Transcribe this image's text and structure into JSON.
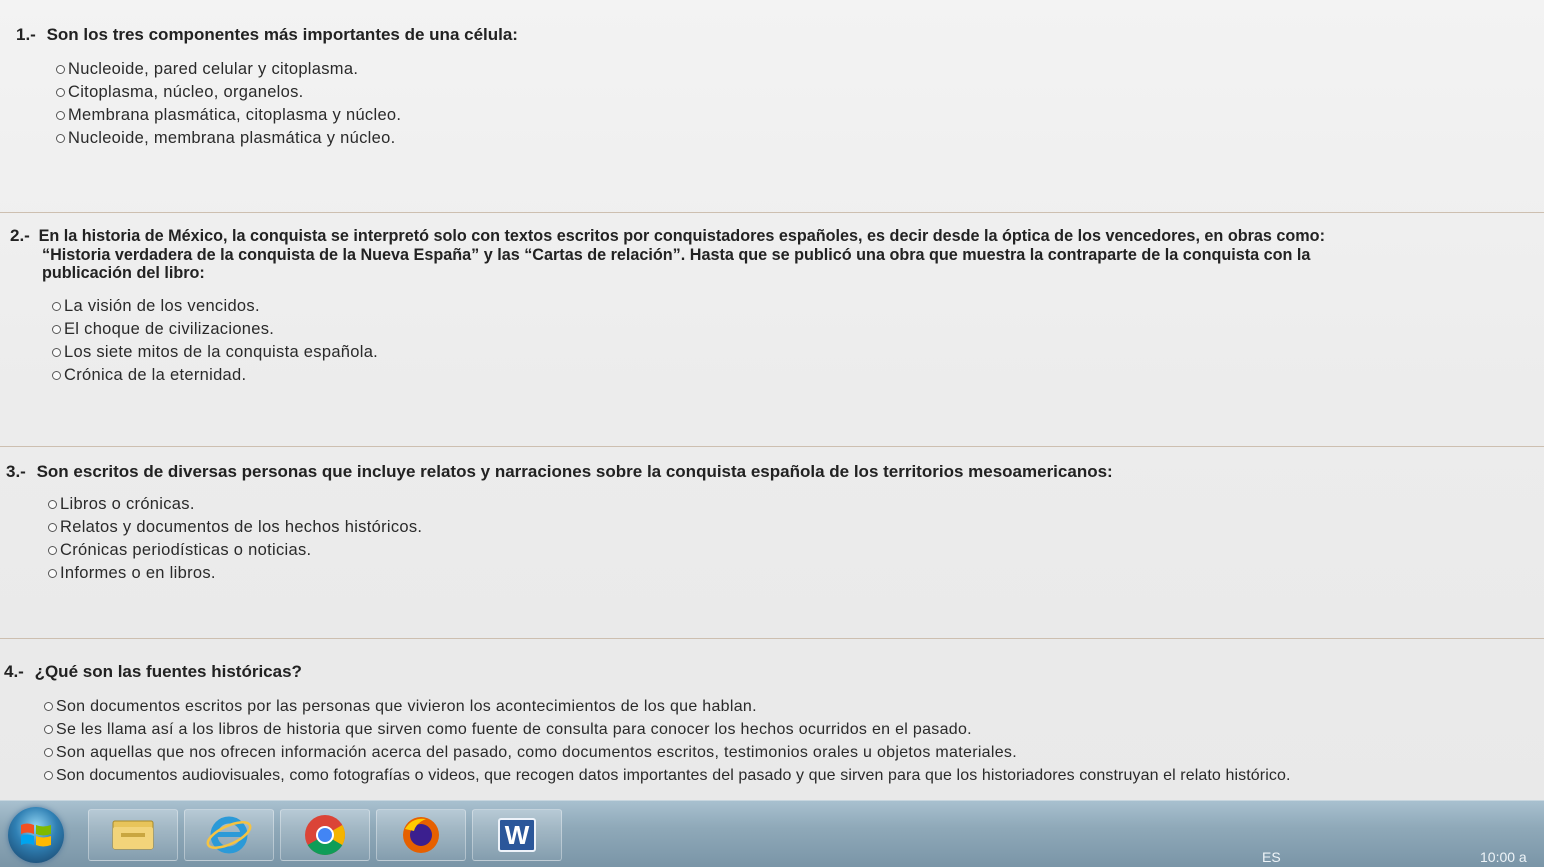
{
  "questions": [
    {
      "number": "1.-",
      "text": "Son los tres componentes más importantes de una célula:",
      "options": [
        "Nucleoide, pared celular y citoplasma.",
        "Citoplasma, núcleo, organelos.",
        "Membrana plasmática, citoplasma y núcleo.",
        "Nucleoide, membrana plasmática y núcleo."
      ]
    },
    {
      "number": "2.-",
      "text_lines": [
        "En la historia de México, la conquista se interpretó solo con textos escritos por conquistadores españoles, es decir desde la óptica de los vencedores, en obras como:",
        "“Historia verdadera de la conquista de la Nueva España” y las “Cartas de relación”. Hasta que se publicó una obra que muestra la contraparte de la conquista con la",
        "publicación del libro:"
      ],
      "options": [
        "La visión de los vencidos.",
        "El choque de civilizaciones.",
        "Los siete mitos de la conquista española.",
        "Crónica de la eternidad."
      ]
    },
    {
      "number": "3.-",
      "text": "Son escritos de diversas personas que incluye relatos y narraciones sobre la conquista española de los territorios mesoamericanos:",
      "options": [
        "Libros o crónicas.",
        "Relatos y documentos de los hechos históricos.",
        "Crónicas periodísticas o noticias.",
        "Informes o en libros."
      ]
    },
    {
      "number": "4.-",
      "text": "¿Qué son las fuentes históricas?",
      "options": [
        "Son documentos escritos por las personas que vivieron los acontecimientos de los que hablan.",
        "Se les llama así a los libros de historia que sirven como fuente de consulta para conocer los hechos ocurridos en el pasado.",
        "Son aquellas que nos ofrecen información acerca del pasado, como documentos escritos, testimonios orales u objetos materiales.",
        "Son documentos audiovisuales, como fotografías o videos, que recogen datos importantes del pasado y que sirven para que los historiadores construyan el relato histórico."
      ]
    }
  ],
  "taskbar": {
    "apps": [
      "windows-start-icon",
      "file-explorer-icon",
      "internet-explorer-icon",
      "chrome-icon",
      "firefox-icon",
      "word-icon"
    ],
    "word_letter": "W",
    "language": "ES",
    "clock": "10:00 a"
  }
}
